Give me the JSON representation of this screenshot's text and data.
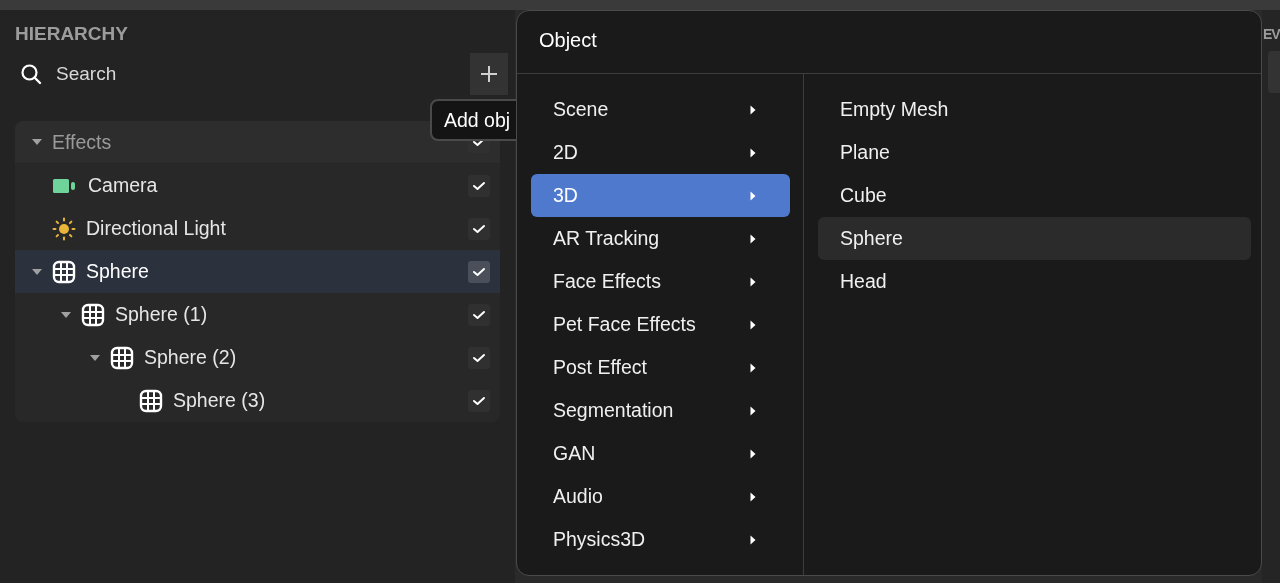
{
  "hierarchy": {
    "title": "HIERARCHY",
    "search": {
      "placeholder": "Search"
    },
    "add_tooltip": "Add obj",
    "tree": [
      {
        "label": "Effects",
        "kind": "group",
        "expanded": true,
        "visible": true,
        "selected": false,
        "children": [
          {
            "label": "Camera",
            "kind": "camera",
            "visible": true,
            "selected": false
          },
          {
            "label": "Directional Light",
            "kind": "light",
            "visible": true,
            "selected": false
          },
          {
            "label": "Sphere",
            "kind": "mesh",
            "expanded": true,
            "visible": true,
            "selected": true,
            "children": [
              {
                "label": "Sphere (1)",
                "kind": "mesh",
                "expanded": true,
                "visible": true,
                "selected": false,
                "children": [
                  {
                    "label": "Sphere (2)",
                    "kind": "mesh",
                    "expanded": true,
                    "visible": true,
                    "selected": false,
                    "children": [
                      {
                        "label": "Sphere (3)",
                        "kind": "mesh",
                        "visible": true,
                        "selected": false
                      }
                    ]
                  }
                ]
              }
            ]
          }
        ]
      }
    ]
  },
  "menu": {
    "title": "Object",
    "categories": [
      {
        "label": "Scene",
        "selected": false
      },
      {
        "label": "2D",
        "selected": false
      },
      {
        "label": "3D",
        "selected": true
      },
      {
        "label": "AR Tracking",
        "selected": false
      },
      {
        "label": "Face Effects",
        "selected": false
      },
      {
        "label": "Pet Face Effects",
        "selected": false
      },
      {
        "label": "Post Effect",
        "selected": false
      },
      {
        "label": "Segmentation",
        "selected": false
      },
      {
        "label": "GAN",
        "selected": false
      },
      {
        "label": "Audio",
        "selected": false
      },
      {
        "label": "Physics3D",
        "selected": false
      }
    ],
    "items": [
      {
        "label": "Empty Mesh",
        "selected": false
      },
      {
        "label": "Plane",
        "selected": false
      },
      {
        "label": "Cube",
        "selected": false
      },
      {
        "label": "Sphere",
        "selected": true
      },
      {
        "label": "Head",
        "selected": false
      }
    ]
  },
  "right_panel": {
    "title": "EV"
  }
}
